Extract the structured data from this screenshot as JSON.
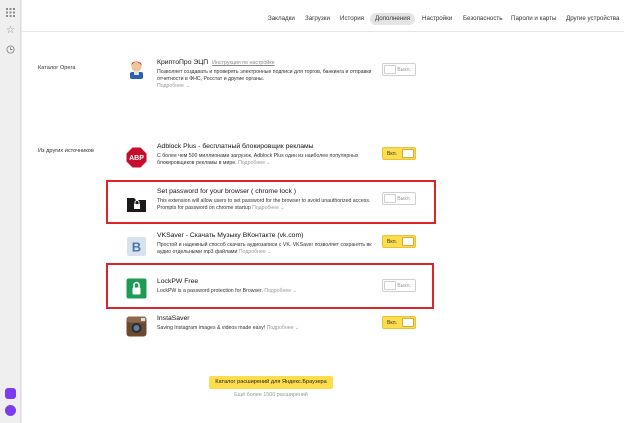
{
  "leftbar": {
    "icons": [
      "grid-icon",
      "star-icon",
      "clock-icon"
    ],
    "bottom_icons": [
      "alice-icon",
      "assistant-icon"
    ]
  },
  "nav": {
    "tabs": [
      "Закладки",
      "Загрузки",
      "История",
      "Дополнения",
      "Настройки",
      "Безопасность",
      "Пароли и карты",
      "Другие устройства"
    ],
    "active": "Дополнения"
  },
  "sections": {
    "opera": "Каталог Opera",
    "other": "Из других источников"
  },
  "extensions": [
    {
      "title": "КриптоПро ЭЦП",
      "link": "Инструкция по настройке",
      "desc": "Позволяет создавать и проверять электронные подписи для торгов, банкинга и отправки отчетности в ФНС, Росстат и другие органы.",
      "more": "Подробнее",
      "toggle": "Выкл.",
      "enabled": false
    },
    {
      "title": "Adblock Plus - бесплатный блокировщик рекламы",
      "desc": "С более чем 500 миллионами загрузок, Adblock Plus один из наиболее популярных блокировщиков рекламы в мире.",
      "more": "Подробнее",
      "toggle": "Вкл.",
      "enabled": true
    },
    {
      "title": "Set password for your browser ( chrome lock )",
      "desc": "This extension will allow users to set password for the browser to avoid unauthorized access. Prompts for password on chrome startup",
      "more": "Подробнее",
      "toggle": "Выкл.",
      "enabled": false
    },
    {
      "title": "VKSaver - Скачать Музыку ВКонтакте (vk.com)",
      "desc": "Простой и надежный способ скачать аудиозаписи с VK. VKSaver позволяет сохранять вк аудио отдельными mp3 файлами",
      "more": "Подробнее",
      "toggle": "Вкл.",
      "enabled": true
    },
    {
      "title": "LockPW Free",
      "desc": "LockPW is a password protection for Browser.",
      "more": "Подробнее",
      "toggle": "Выкл.",
      "enabled": false
    },
    {
      "title": "InstaSaver",
      "desc": "Saving Instagram images & videos made easy!",
      "more": "Подробнее",
      "toggle": "Вкл.",
      "enabled": true
    }
  ],
  "catalog": {
    "button": "Каталог расширений для Яндекс.Браузера",
    "sub": "Ещё более 1500 расширений"
  },
  "colors": {
    "toggle_on": "#ffdc4b",
    "highlight": "#d9262b",
    "lockpw_green": "#1d9a55"
  }
}
